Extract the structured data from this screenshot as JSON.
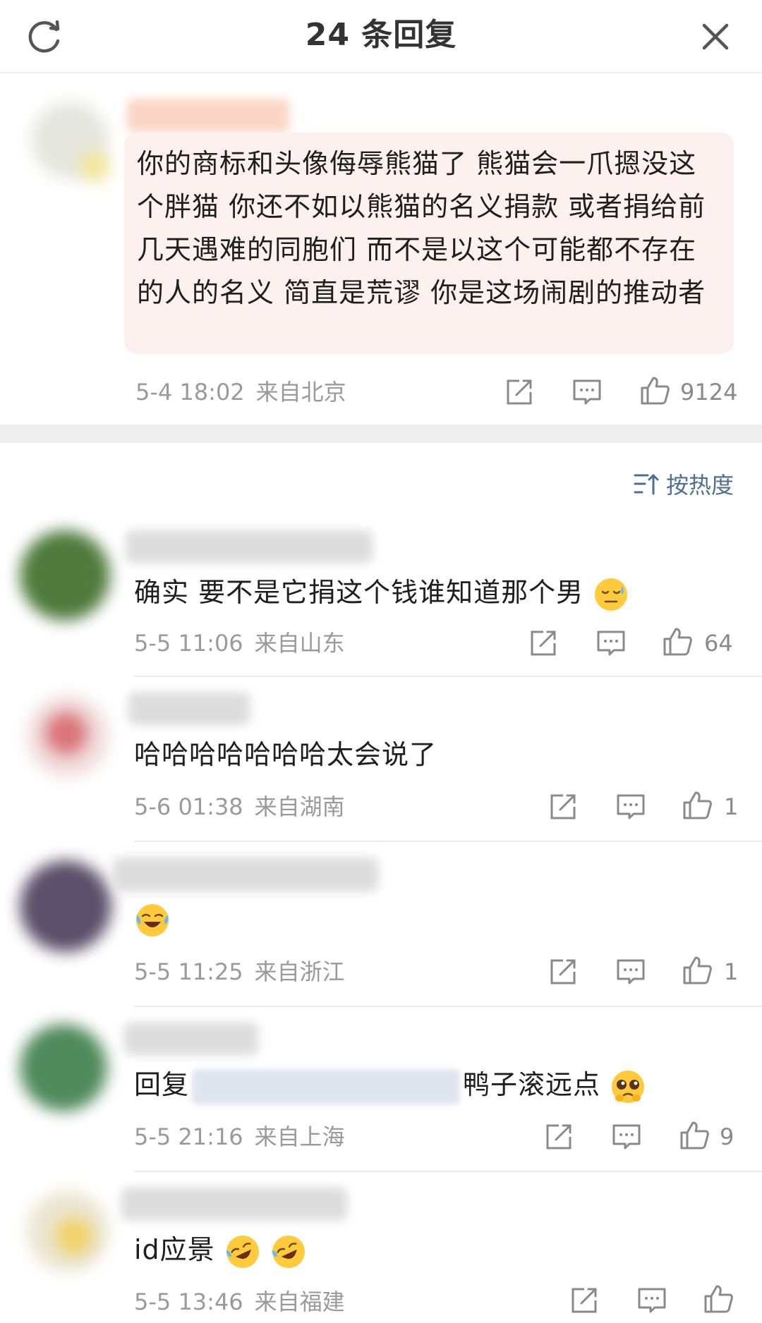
{
  "header": {
    "title": "24 条回复"
  },
  "main_comment": {
    "text": "你的商标和头像侮辱熊猫了 熊猫会一爪摁没这个胖猫 你还不如以熊猫的名义捐款 或者捐给前几天遇难的同胞们 而不是以这个可能都不存在的人的名义 简直是荒谬 你是这场闹剧的推动者",
    "date": "5-4 18:02",
    "location": "来自北京",
    "likes": "9124"
  },
  "sort": {
    "label": "按热度"
  },
  "replies": [
    {
      "text": "确实 要不是它捐这个钱谁知道那个男",
      "emoji": "sweat-face",
      "date": "5-5 11:06",
      "location": "来自山东",
      "likes": "64"
    },
    {
      "text": "哈哈哈哈哈哈哈太会说了",
      "date": "5-6 01:38",
      "location": "来自湖南",
      "likes": "1"
    },
    {
      "text": "",
      "emoji": "crying-laughing-face",
      "date": "5-5 11:25",
      "location": "来自浙江",
      "likes": "1"
    },
    {
      "prefix": "回复",
      "suffix": "鸭子滚远点",
      "emoji": "pleading-face",
      "date": "5-5 21:16",
      "location": "来自上海",
      "likes": "9"
    },
    {
      "text": "id应景",
      "emoji": "rofl-face",
      "date": "5-5 13:46",
      "location": "来自福建",
      "likes": ""
    }
  ],
  "colors": {
    "bubble": "#fdf1ef",
    "sort_link": "#4d6f92",
    "meta": "#9a9a9a",
    "separator": "#eeeeee"
  }
}
